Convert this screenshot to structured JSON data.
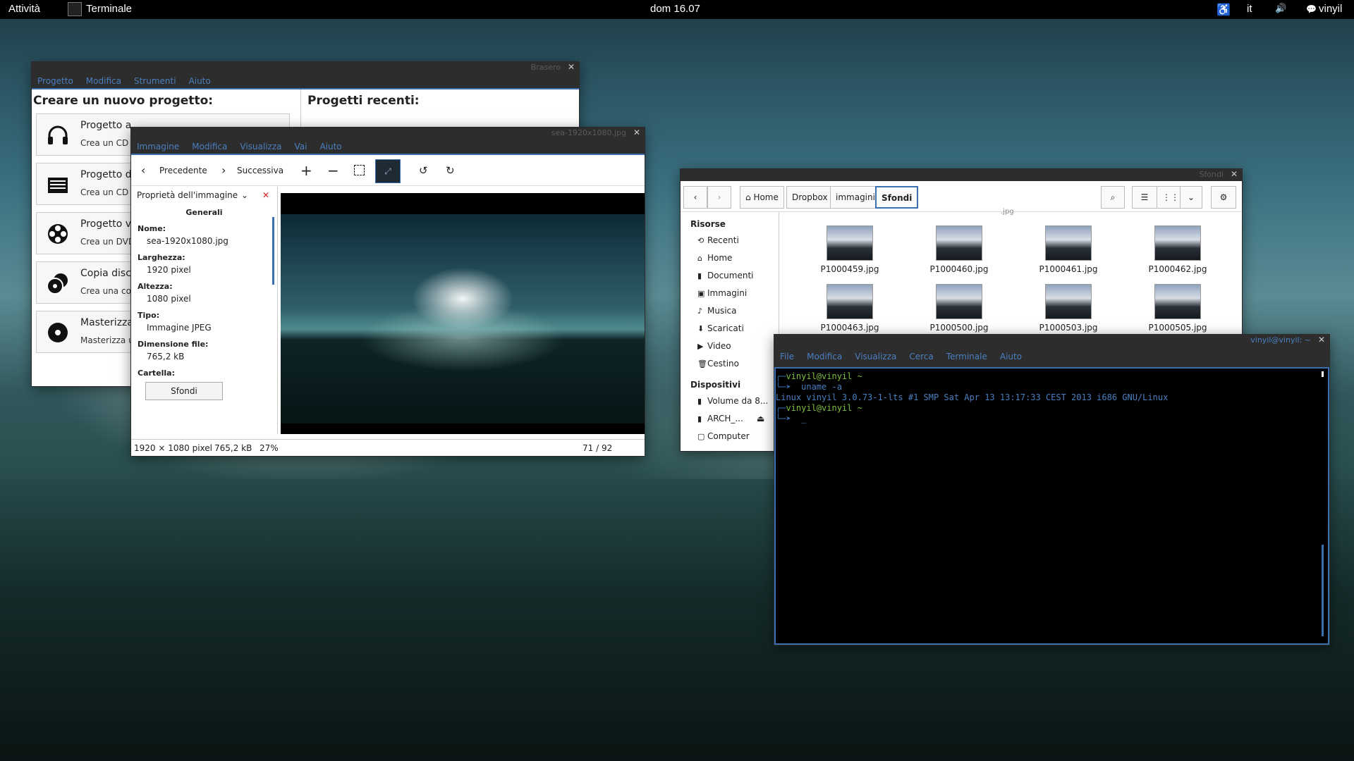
{
  "topbar": {
    "activities": "Attività",
    "app": "Terminale",
    "clock": "dom 16.07",
    "lang": "it",
    "user": "vinyil"
  },
  "brasero": {
    "title": "Brasero",
    "menu": [
      "Progetto",
      "Modifica",
      "Strumenti",
      "Aiuto"
    ],
    "new_heading": "Creare un nuovo progetto:",
    "recent_heading": "Progetti recenti:",
    "projects": [
      {
        "title": "Progetto a",
        "subtitle": "Crea un CD a",
        "icon": "headphones-icon"
      },
      {
        "title": "Progetto d",
        "subtitle": "Crea un CD d",
        "icon": "data-disc-icon"
      },
      {
        "title": "Progetto v",
        "subtitle": "Crea un DVD",
        "icon": "film-reel-icon"
      },
      {
        "title": "Copia disco",
        "subtitle": "Crea una cop",
        "icon": "copy-disc-icon"
      },
      {
        "title": "Masterizza",
        "subtitle": "Masterizza u",
        "icon": "disc-icon"
      }
    ]
  },
  "viewer": {
    "title": "sea-1920x1080.jpg",
    "menu": [
      "Immagine",
      "Modifica",
      "Visualizza",
      "Vai",
      "Aiuto"
    ],
    "prev": "Precedente",
    "next": "Successiva",
    "sidebar_title": "Proprietà dell'immagine",
    "section": "Generali",
    "props": [
      {
        "label": "Nome:",
        "value": "sea-1920x1080.jpg"
      },
      {
        "label": "Larghezza:",
        "value": "1920 pixel"
      },
      {
        "label": "Altezza:",
        "value": "1080 pixel"
      },
      {
        "label": "Tipo:",
        "value": "Immagine JPEG"
      },
      {
        "label": "Dimensione file:",
        "value": "765,2 kB"
      }
    ],
    "folder_label": "Cartella:",
    "folder_button": "Sfondi",
    "status_dims": "1920 × 1080 pixel",
    "status_size": "765,2 kB",
    "status_zoom": "27%",
    "status_index": "71 / 92"
  },
  "files": {
    "title": "Sfondi",
    "crumbs": [
      "Home",
      "Dropbox",
      "immagini",
      "Sfondi"
    ],
    "sections": [
      {
        "title": "Risorse",
        "items": [
          "Recenti",
          "Home",
          "Documenti",
          "Immagini",
          "Musica",
          "Scaricati",
          "Video",
          "Cestino"
        ]
      },
      {
        "title": "Dispositivi",
        "items": [
          "Volume da 8...",
          "ARCH_...",
          "Computer"
        ]
      }
    ],
    "partial_name": ".jpg",
    "thumbs": [
      "P1000459.jpg",
      "P1000460.jpg",
      "P1000461.jpg",
      "P1000462.jpg",
      "P1000463.jpg",
      "P1000500.jpg",
      "P1000503.jpg",
      "P1000505.jpg"
    ]
  },
  "terminal": {
    "title": "vinyil@vinyil: ~",
    "menu": [
      "File",
      "Modifica",
      "Visualizza",
      "Cerca",
      "Terminale",
      "Aiuto"
    ],
    "prompt1": "vinyil@vinyil ~",
    "cmd1": "uname -a",
    "output1": "Linux vinyil 3.0.73-1-lts #1 SMP Sat Apr 13 13:17:33 CEST 2013 i686 GNU/Linux",
    "prompt2": "vinyil@vinyil ~",
    "cursor": "_"
  },
  "colors": {
    "accent": "#3a6fb0",
    "prompt_green": "#7fbf3f",
    "menu_blue": "#4a7fc0"
  }
}
